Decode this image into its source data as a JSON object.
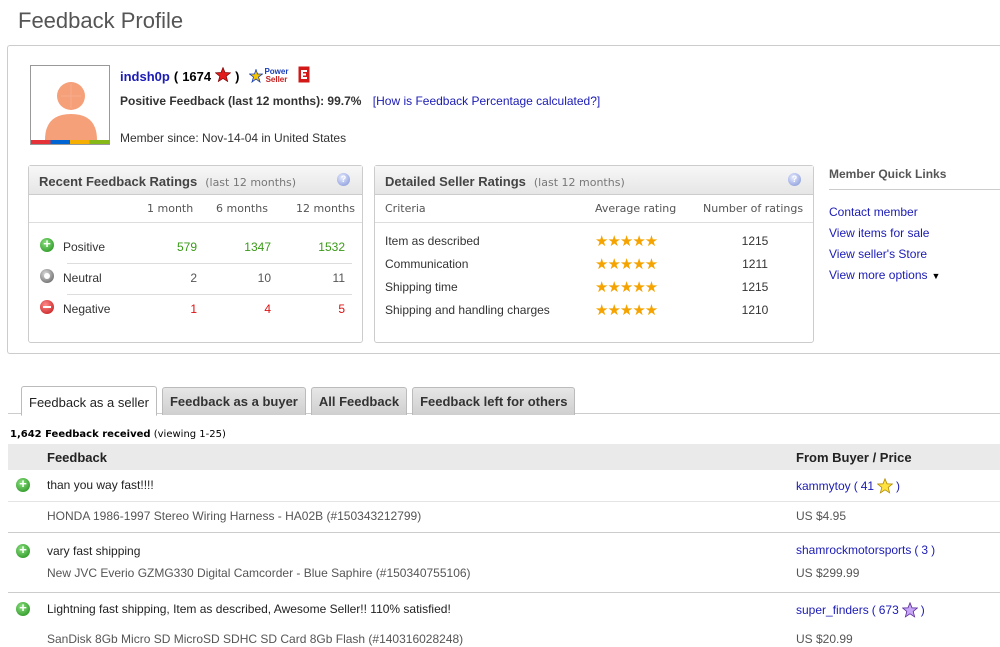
{
  "page_title": "Feedback Profile",
  "profile": {
    "username": "indsh0p",
    "score_open": "(",
    "score": "1674",
    "score_close": ")",
    "power_seller_line1": "Power",
    "power_seller_line2": "Seller",
    "positive_label": "Positive Feedback (last 12 months): 99.7%",
    "percentage_link": "[How is Feedback Percentage calculated?]",
    "member_since": "Member since: Nov-14-04 in United States"
  },
  "recent_ratings": {
    "title": "Recent Feedback Ratings",
    "subtitle": "(last 12 months)",
    "columns": [
      "1 month",
      "6 months",
      "12 months"
    ],
    "rows": [
      {
        "label": "Positive",
        "values": [
          "579",
          "1347",
          "1532"
        ],
        "color": "#3a9a18",
        "icon": "positive-icon"
      },
      {
        "label": "Neutral",
        "values": [
          "2",
          "10",
          "11"
        ],
        "color": "#555555",
        "icon": "neutral-icon"
      },
      {
        "label": "Negative",
        "values": [
          "1",
          "4",
          "5"
        ],
        "color": "#dd1111",
        "icon": "negative-icon"
      }
    ]
  },
  "dsr": {
    "title": "Detailed Seller Ratings",
    "subtitle": "(last 12 months)",
    "columns": [
      "Criteria",
      "Average rating",
      "Number of ratings"
    ],
    "rows": [
      {
        "criteria": "Item as described",
        "stars": 5,
        "count": "1215"
      },
      {
        "criteria": "Communication",
        "stars": 5,
        "count": "1211"
      },
      {
        "criteria": "Shipping time",
        "stars": 5,
        "count": "1215"
      },
      {
        "criteria": "Shipping and handling charges",
        "stars": 5,
        "count": "1210"
      }
    ]
  },
  "quick_links": {
    "title": "Member Quick Links",
    "links": [
      "Contact member",
      "View items for sale",
      "View seller's Store",
      "View more options"
    ]
  },
  "tabs": [
    "Feedback as a seller",
    "Feedback as a buyer",
    "All Feedback",
    "Feedback left for others"
  ],
  "active_tab": 0,
  "received": {
    "count_label": "1,642 Feedback received",
    "viewing": "(viewing 1-25)"
  },
  "feedback_table": {
    "col_feedback": "Feedback",
    "col_from": "From Buyer / Price",
    "rows": [
      {
        "comment": "than you way fast!!!!",
        "item": "HONDA 1986-1997 Stereo Wiring Harness - HA02B (#150343212799)",
        "buyer": "kammytoy",
        "score": "41",
        "star": "yellow-star-icon",
        "price": "US $4.95"
      },
      {
        "comment": "vary fast shipping",
        "item": "New JVC Everio GZMG330 Digital Camcorder - Blue Saphire (#150340755106)",
        "buyer": "shamrockmotorsports",
        "score": "3",
        "star": "",
        "price": "US $299.99"
      },
      {
        "comment": "Lightning fast shipping, Item as described, Awesome Seller!! 110% satisfied!",
        "item": "SanDisk 8Gb Micro SD MicroSD SDHC SD Card 8Gb Flash (#140316028248)",
        "buyer": "super_finders",
        "score": "673",
        "star": "purple-star-icon",
        "price": "US $20.99"
      }
    ]
  },
  "colors": {
    "link": "#1b1bb5",
    "positive": "#3a9a18",
    "negative": "#dd1111",
    "star": "#f5a300"
  }
}
